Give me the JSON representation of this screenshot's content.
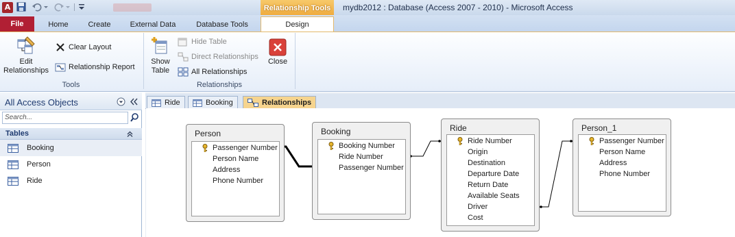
{
  "window": {
    "title": "mydb2012 : Database (Access 2007 - 2010)  -  Microsoft Access",
    "app_icon": "A",
    "contextual_header": "Relationship Tools"
  },
  "ribbon_tabs": {
    "file": "File",
    "home": "Home",
    "create": "Create",
    "external_data": "External Data",
    "database_tools": "Database Tools",
    "design": "Design"
  },
  "ribbon": {
    "tools": {
      "label": "Tools",
      "edit_relationships": [
        "Edit",
        "Relationships"
      ],
      "clear_layout": "Clear Layout",
      "relationship_report": "Relationship Report"
    },
    "relationships": {
      "label": "Relationships",
      "show_table": [
        "Show",
        "Table"
      ],
      "hide_table": "Hide Table",
      "direct_relationships": "Direct Relationships",
      "all_relationships": "All Relationships",
      "close": "Close"
    }
  },
  "nav_pane": {
    "title": "All Access Objects",
    "search_placeholder": "Search...",
    "group": "Tables",
    "items": [
      "Booking",
      "Person",
      "Ride"
    ]
  },
  "doc_tabs": [
    "Ride",
    "Booking",
    "Relationships"
  ],
  "tables": [
    {
      "name": "Person",
      "fields": [
        "Passenger Number",
        "Person Name",
        "Address",
        "Phone Number"
      ],
      "keys": [
        0
      ]
    },
    {
      "name": "Booking",
      "fields": [
        "Booking Number",
        "Ride Number",
        "Passenger Number"
      ],
      "keys": [
        0
      ]
    },
    {
      "name": "Ride",
      "fields": [
        "Ride Number",
        "Origin",
        "Destination",
        "Departure Date",
        "Return Date",
        "Available Seats",
        "Driver",
        "Cost"
      ],
      "keys": [
        0
      ]
    },
    {
      "name": "Person_1",
      "fields": [
        "Passenger Number",
        "Person Name",
        "Address",
        "Phone Number"
      ],
      "keys": [
        0
      ]
    }
  ],
  "colors": {
    "file_tab": "#b11f34",
    "contextual_tab": "#eea93c",
    "active_doc_tab": "#f6d48e",
    "nav_text": "#1f3b70"
  }
}
